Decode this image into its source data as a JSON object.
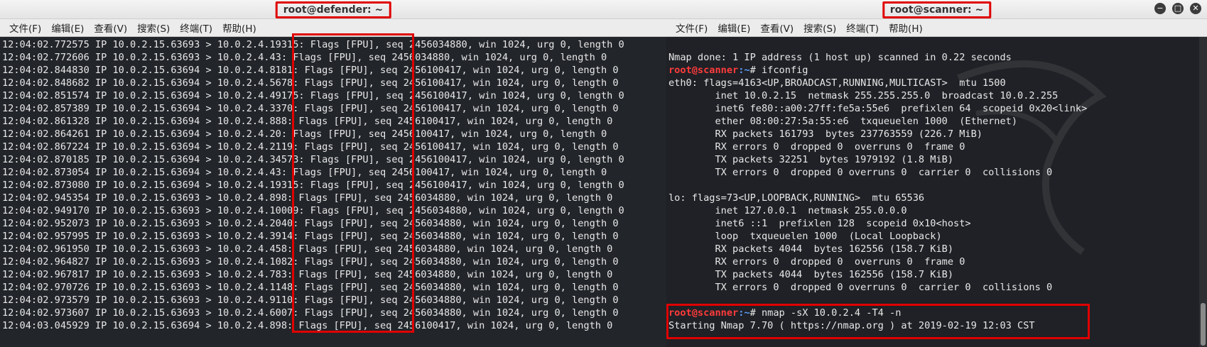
{
  "left": {
    "title": "root@defender: ~",
    "menu": [
      "文件(F)",
      "编辑(E)",
      "查看(V)",
      "搜索(S)",
      "终端(T)",
      "帮助(H)"
    ],
    "lines": [
      "12:04:02.772575 IP 10.0.2.15.63693 > 10.0.2.4.19315: Flags [FPU], seq 2456034880, win 1024, urg 0, length 0",
      "12:04:02.772606 IP 10.0.2.15.63693 > 10.0.2.4.43: Flags [FPU], seq 2456034880, win 1024, urg 0, length 0",
      "12:04:02.844830 IP 10.0.2.15.63694 > 10.0.2.4.8181: Flags [FPU], seq 2456100417, win 1024, urg 0, length 0",
      "12:04:02.848682 IP 10.0.2.15.63694 > 10.0.2.4.5678: Flags [FPU], seq 2456100417, win 1024, urg 0, length 0",
      "12:04:02.851574 IP 10.0.2.15.63694 > 10.0.2.4.49175: Flags [FPU], seq 2456100417, win 1024, urg 0, length 0",
      "12:04:02.857389 IP 10.0.2.15.63694 > 10.0.2.4.3370: Flags [FPU], seq 2456100417, win 1024, urg 0, length 0",
      "12:04:02.861328 IP 10.0.2.15.63694 > 10.0.2.4.888: Flags [FPU], seq 2456100417, win 1024, urg 0, length 0",
      "12:04:02.864261 IP 10.0.2.15.63694 > 10.0.2.4.20: Flags [FPU], seq 2456100417, win 1024, urg 0, length 0",
      "12:04:02.867224 IP 10.0.2.15.63694 > 10.0.2.4.2119: Flags [FPU], seq 2456100417, win 1024, urg 0, length 0",
      "12:04:02.870185 IP 10.0.2.15.63694 > 10.0.2.4.34573: Flags [FPU], seq 2456100417, win 1024, urg 0, length 0",
      "12:04:02.873054 IP 10.0.2.15.63694 > 10.0.2.4.43: Flags [FPU], seq 2456100417, win 1024, urg 0, length 0",
      "12:04:02.873080 IP 10.0.2.15.63694 > 10.0.2.4.19315: Flags [FPU], seq 2456100417, win 1024, urg 0, length 0",
      "12:04:02.945354 IP 10.0.2.15.63693 > 10.0.2.4.898: Flags [FPU], seq 2456034880, win 1024, urg 0, length 0",
      "12:04:02.949170 IP 10.0.2.15.63693 > 10.0.2.4.10009: Flags [FPU], seq 2456034880, win 1024, urg 0, length 0",
      "12:04:02.952073 IP 10.0.2.15.63693 > 10.0.2.4.2040: Flags [FPU], seq 2456034880, win 1024, urg 0, length 0",
      "12:04:02.957995 IP 10.0.2.15.63693 > 10.0.2.4.3914: Flags [FPU], seq 2456034880, win 1024, urg 0, length 0",
      "12:04:02.961950 IP 10.0.2.15.63693 > 10.0.2.4.458: Flags [FPU], seq 2456034880, win 1024, urg 0, length 0",
      "12:04:02.964827 IP 10.0.2.15.63693 > 10.0.2.4.1082: Flags [FPU], seq 2456034880, win 1024, urg 0, length 0",
      "12:04:02.967817 IP 10.0.2.15.63693 > 10.0.2.4.783: Flags [FPU], seq 2456034880, win 1024, urg 0, length 0",
      "12:04:02.970726 IP 10.0.2.15.63693 > 10.0.2.4.1148: Flags [FPU], seq 2456034880, win 1024, urg 0, length 0",
      "12:04:02.973579 IP 10.0.2.15.63693 > 10.0.2.4.9110: Flags [FPU], seq 2456034880, win 1024, urg 0, length 0",
      "12:04:02.973607 IP 10.0.2.15.63693 > 10.0.2.4.6007: Flags [FPU], seq 2456034880, win 1024, urg 0, length 0",
      "12:04:03.045929 IP 10.0.2.15.63694 > 10.0.2.4.898: Flags [FPU], seq 2456100417, win 1024, urg 0, length 0"
    ]
  },
  "right": {
    "title": "root@scanner: ~",
    "menu": [
      "文件(F)",
      "编辑(E)",
      "查看(V)",
      "搜索(S)",
      "终端(T)",
      "帮助(H)"
    ],
    "buttons": {
      "minimize": "−",
      "maximize": "□",
      "close": "✕"
    },
    "prompt_user": "root@scanner",
    "prompt_path": ":~",
    "prompt_symbol": "# ",
    "lines": [
      {
        "type": "text",
        "text": ""
      },
      {
        "type": "text",
        "text": "Nmap done: 1 IP address (1 host up) scanned in 0.22 seconds"
      },
      {
        "type": "prompt",
        "cmd": "ifconfig"
      },
      {
        "type": "text",
        "text": "eth0: flags=4163<UP,BROADCAST,RUNNING,MULTICAST>  mtu 1500"
      },
      {
        "type": "text",
        "text": "        inet 10.0.2.15  netmask 255.255.255.0  broadcast 10.0.2.255"
      },
      {
        "type": "text",
        "text": "        inet6 fe80::a00:27ff:fe5a:55e6  prefixlen 64  scopeid 0x20<link>"
      },
      {
        "type": "text",
        "text": "        ether 08:00:27:5a:55:e6  txqueuelen 1000  (Ethernet)"
      },
      {
        "type": "text",
        "text": "        RX packets 161793  bytes 237763559 (226.7 MiB)"
      },
      {
        "type": "text",
        "text": "        RX errors 0  dropped 0  overruns 0  frame 0"
      },
      {
        "type": "text",
        "text": "        TX packets 32251  bytes 1979192 (1.8 MiB)"
      },
      {
        "type": "text",
        "text": "        TX errors 0  dropped 0 overruns 0  carrier 0  collisions 0"
      },
      {
        "type": "text",
        "text": ""
      },
      {
        "type": "text",
        "text": "lo: flags=73<UP,LOOPBACK,RUNNING>  mtu 65536"
      },
      {
        "type": "text",
        "text": "        inet 127.0.0.1  netmask 255.0.0.0"
      },
      {
        "type": "text",
        "text": "        inet6 ::1  prefixlen 128  scopeid 0x10<host>"
      },
      {
        "type": "text",
        "text": "        loop  txqueuelen 1000  (Local Loopback)"
      },
      {
        "type": "text",
        "text": "        RX packets 4044  bytes 162556 (158.7 KiB)"
      },
      {
        "type": "text",
        "text": "        RX errors 0  dropped 0  overruns 0  frame 0"
      },
      {
        "type": "text",
        "text": "        TX packets 4044  bytes 162556 (158.7 KiB)"
      },
      {
        "type": "text",
        "text": "        TX errors 0  dropped 0 overruns 0  carrier 0  collisions 0"
      },
      {
        "type": "text",
        "text": ""
      },
      {
        "type": "prompt",
        "cmd": "nmap -sX 10.0.2.4 -T4 -n"
      },
      {
        "type": "text",
        "text": "Starting Nmap 7.70 ( https://nmap.org ) at 2019-02-19 12:03 CST"
      }
    ]
  },
  "colors": {
    "highlight": "#e00000",
    "prompt_user": "#ff3b3b",
    "prompt_path": "#5b9cff"
  }
}
